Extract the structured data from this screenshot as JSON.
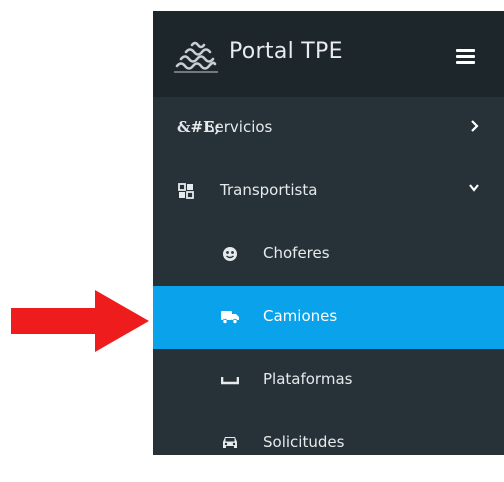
{
  "sidebar": {
    "brand": {
      "title": "Portal TPE",
      "logo_icon": "waves-logo-icon"
    },
    "menu_toggle_icon": "hamburger-icon",
    "items": [
      {
        "prefix": "&#E;",
        "label": "Servicios",
        "chevron": "chevron-right-icon",
        "active": false
      },
      {
        "icon": "grid-icon",
        "label": "Transportista",
        "chevron": "chevron-down-icon",
        "active": false
      },
      {
        "icon": "face-icon",
        "label": "Choferes",
        "active": false
      },
      {
        "icon": "truck-icon",
        "label": "Camiones",
        "active": true
      },
      {
        "icon": "platform-icon",
        "label": "Plataformas",
        "active": false
      },
      {
        "icon": "car-icon",
        "label": "Solicitudes",
        "active": false
      }
    ]
  },
  "annotation": {
    "arrow_icon": "red-arrow-icon",
    "arrow_color": "#ee1c1c"
  },
  "colors": {
    "sidebar_bg": "#263238",
    "header_bg": "#1d262b",
    "active_bg": "#0aa2ea"
  }
}
